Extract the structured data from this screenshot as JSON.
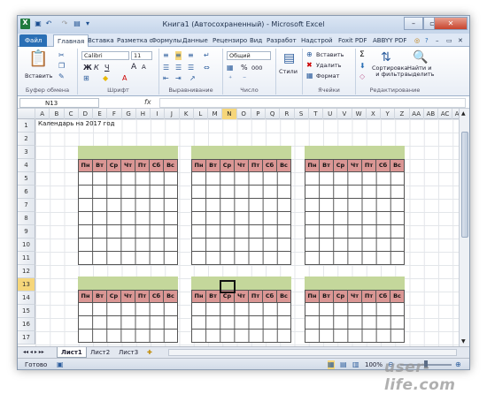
{
  "window": {
    "title": "Книга1 (Автосохраненный)  -  Microsoft Excel",
    "min_icon": "minimize-icon",
    "max_icon": "maximize-icon",
    "close_icon": "close-icon"
  },
  "qat": {
    "excel_icon": "X"
  },
  "tabs": [
    "Файл",
    "Главная",
    "Вставка",
    "Разметка с",
    "Формулы",
    "Данные",
    "Рецензиро",
    "Вид",
    "Разработ",
    "Надстрой",
    "Foxit PDF",
    "ABBYY PDF"
  ],
  "ribbon": {
    "clipboard": {
      "paste": "Вставить",
      "label": "Буфер обмена"
    },
    "font": {
      "name": "Calibri",
      "size": "11",
      "label": "Шрифт",
      "bold": "Ж",
      "italic": "К",
      "underline": "Ч",
      "grow": "A",
      "shrink": "A"
    },
    "alignment": {
      "label": "Выравнивание"
    },
    "number": {
      "format": "Общий",
      "percent": "%",
      "thousands": "000",
      "label": "Число"
    },
    "styles": {
      "label": "Стили"
    },
    "cells": {
      "insert": "Вставить",
      "delete": "Удалить",
      "format": "Формат",
      "label": "Ячейки"
    },
    "editing": {
      "sum": "Σ",
      "sort": "Сортировка\nи фильтр",
      "find": "Найти и\nвыделить",
      "label": "Редактирование"
    }
  },
  "formula_bar": {
    "name_box": "N13",
    "fx": "fx",
    "value": ""
  },
  "columns": [
    "A",
    "B",
    "C",
    "D",
    "E",
    "F",
    "G",
    "H",
    "I",
    "J",
    "K",
    "L",
    "M",
    "N",
    "O",
    "P",
    "Q",
    "R",
    "S",
    "T",
    "U",
    "V",
    "W",
    "X",
    "Y",
    "Z",
    "AA",
    "AB",
    "AC",
    "AD"
  ],
  "selected_column": "N",
  "rows": [
    "1",
    "2",
    "3",
    "4",
    "5",
    "6",
    "7",
    "8",
    "9",
    "10",
    "11",
    "12",
    "13",
    "14",
    "15",
    "16",
    "17"
  ],
  "selected_row": "13",
  "cells": {
    "A1": "Календарь на 2017 год"
  },
  "calendar": {
    "days": [
      "Пн",
      "Вт",
      "Ср",
      "Чт",
      "Пт",
      "Сб",
      "Вс"
    ]
  },
  "sheets": [
    "Лист1",
    "Лист2",
    "Лист3"
  ],
  "active_sheet": "Лист1",
  "status": {
    "ready": "Готово",
    "zoom": "100%"
  },
  "watermark": "user-life.com",
  "colors": {
    "header_green": "#c4d79b",
    "day_row_red": "#da9694",
    "file_tab": "#2a6fb5",
    "selection": "#f6d67a"
  }
}
